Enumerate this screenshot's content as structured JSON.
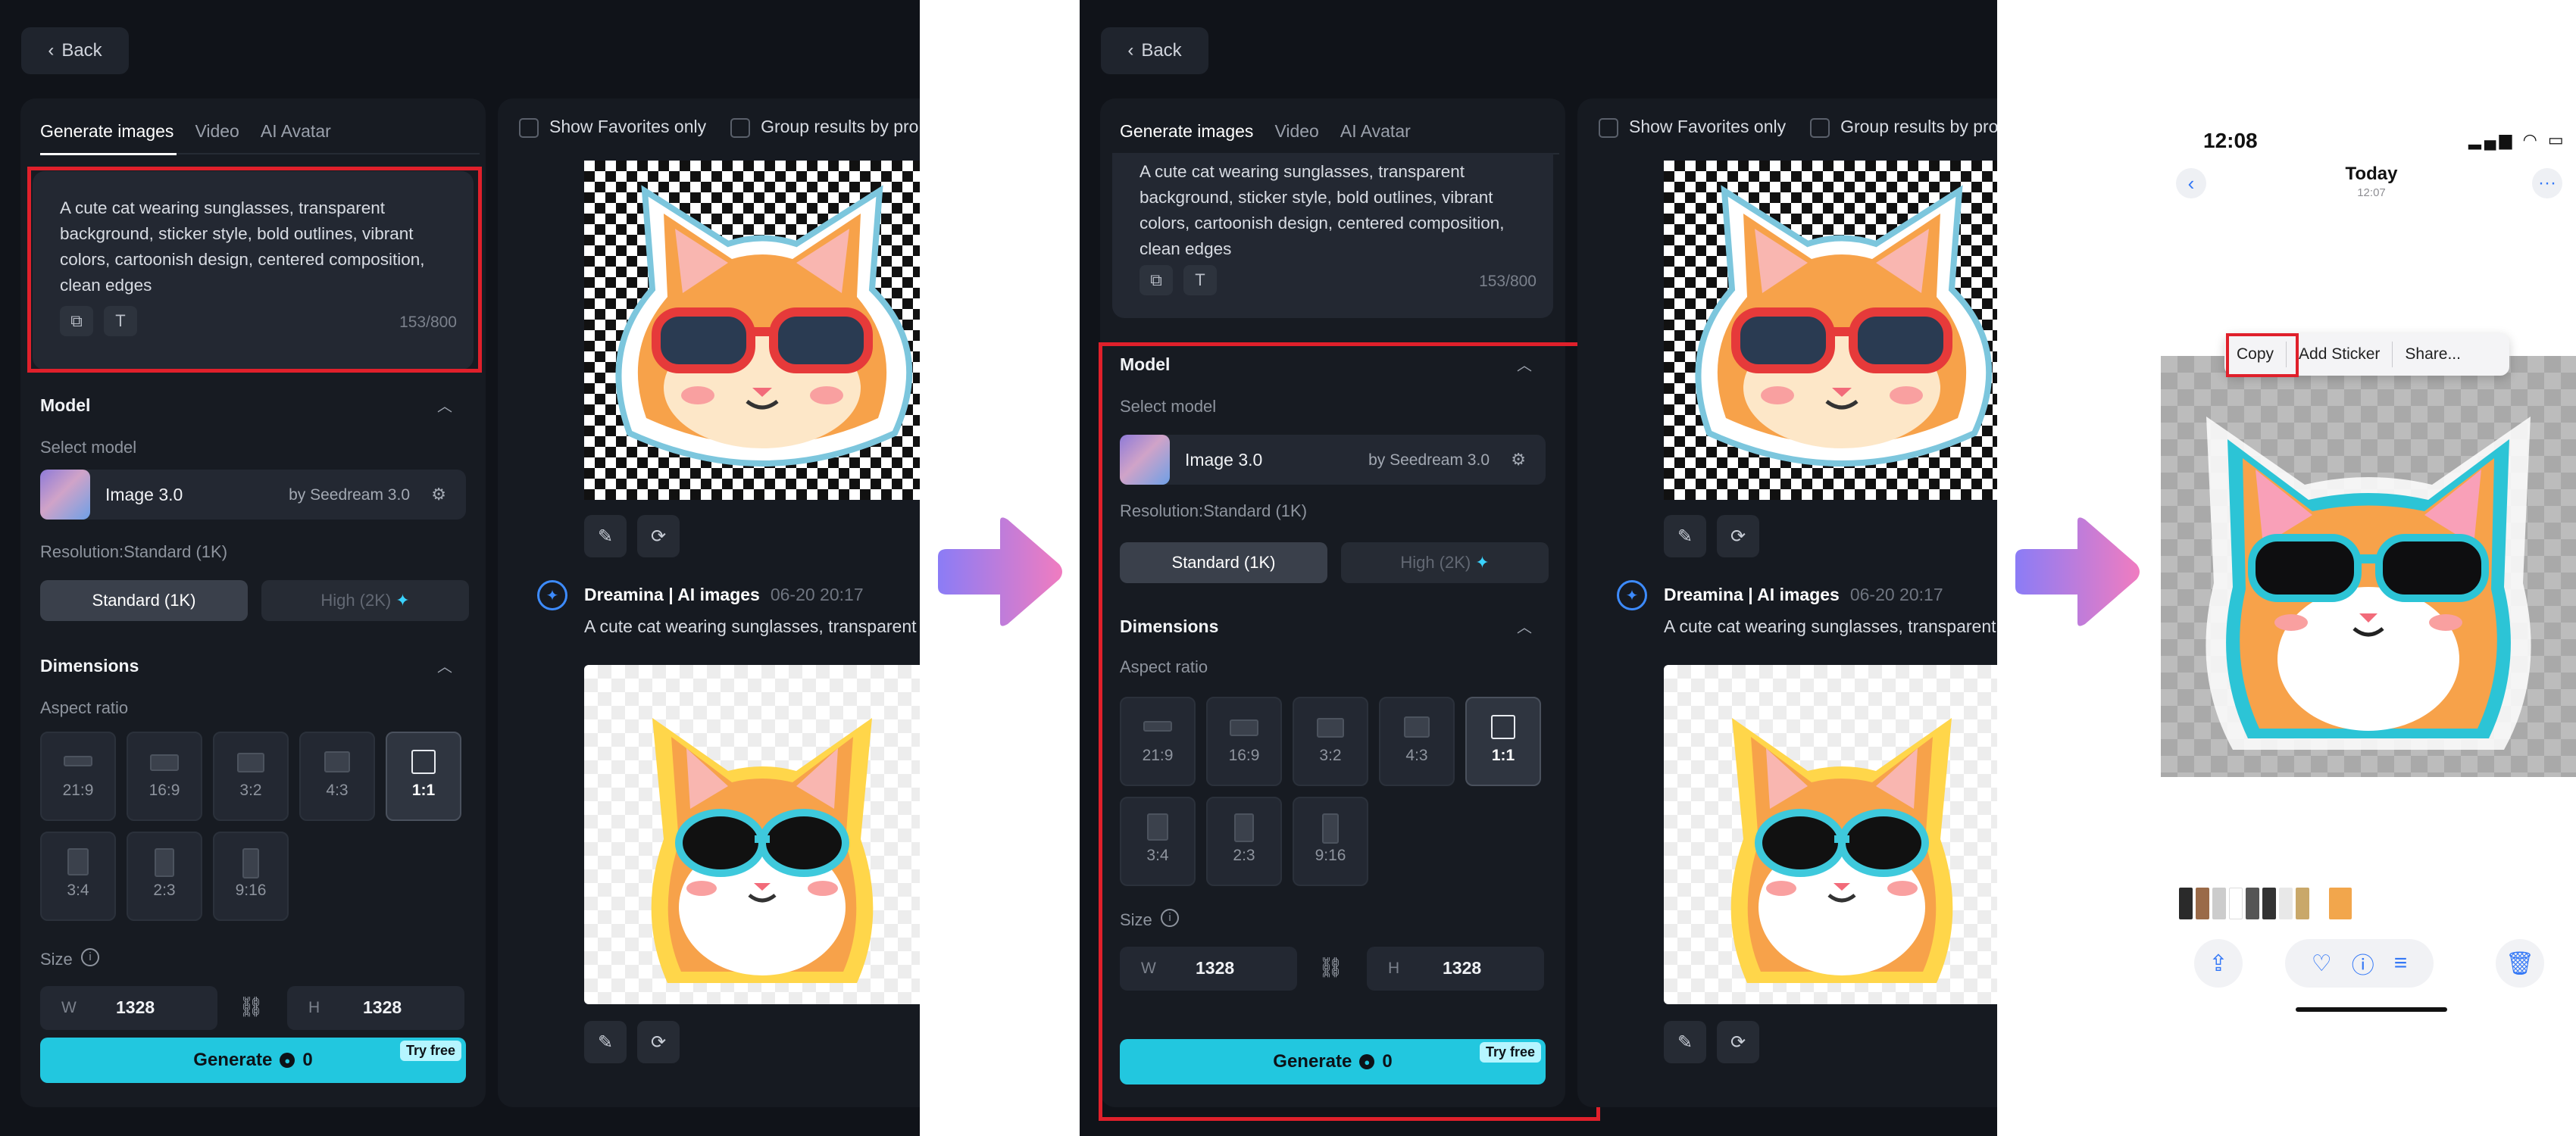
{
  "frame1": {
    "back_label": "Back",
    "tabs": [
      "Generate images",
      "Video",
      "AI Avatar"
    ],
    "prompt": "A cute cat wearing sunglasses, transparent background, sticker style, bold outlines, vibrant colors, cartoonish design, centered composition, clean edges",
    "counter": "153/800",
    "model_section": "Model",
    "select_model_label": "Select model",
    "model_name": "Image 3.0",
    "model_by": "by Seedream 3.0",
    "resolution_label": "Resolution:Standard (1K)",
    "res_standard": "Standard (1K)",
    "res_high": "High (2K)",
    "dimensions_section": "Dimensions",
    "aspect_label": "Aspect ratio",
    "ratios": [
      "21:9",
      "16:9",
      "3:2",
      "4:3",
      "1:1",
      "3:4",
      "2:3",
      "9:16"
    ],
    "selected_ratio": "1:1",
    "size_label": "Size",
    "width_label": "W",
    "width_value": "1328",
    "height_label": "H",
    "height_value": "1328",
    "generate_label": "Generate",
    "generate_cost": "0",
    "try_free": "Try free",
    "filter_favorites": "Show Favorites only",
    "filter_group": "Group results by prom",
    "author": "Dreamina | AI images",
    "author_date": "06-20  20:17",
    "result_prompt": "A cute cat wearing sunglasses, transparent"
  },
  "frame2": {
    "back_label": "Back",
    "tabs": [
      "Generate images",
      "Video",
      "AI Avatar"
    ],
    "prompt": "A cute cat wearing sunglasses, transparent background, sticker style, bold outlines, vibrant colors, cartoonish design, centered composition, clean edges",
    "counter": "153/800",
    "model_section": "Model",
    "select_model_label": "Select model",
    "model_name": "Image 3.0",
    "model_by": "by Seedream 3.0",
    "resolution_label": "Resolution:Standard (1K)",
    "res_standard": "Standard (1K)",
    "res_high": "High (2K)",
    "dimensions_section": "Dimensions",
    "aspect_label": "Aspect ratio",
    "ratios": [
      "21:9",
      "16:9",
      "3:2",
      "4:3",
      "1:1",
      "3:4",
      "2:3",
      "9:16"
    ],
    "selected_ratio": "1:1",
    "size_label": "Size",
    "width_label": "W",
    "width_value": "1328",
    "height_label": "H",
    "height_value": "1328",
    "generate_label": "Generate",
    "generate_cost": "0",
    "try_free": "Try free",
    "filter_favorites": "Show Favorites only",
    "filter_group": "Group results by prom",
    "author": "Dreamina | AI images",
    "author_date": "06-20  20:17",
    "result_prompt": "A cute cat wearing sunglasses, transparent"
  },
  "phone": {
    "time": "12:08",
    "title": "Today",
    "subtitle": "12:07",
    "menu": [
      "Copy",
      "Add Sticker",
      "Share..."
    ]
  },
  "colors": {
    "accent": "#22c7df",
    "highlight_box": "#e0202b",
    "ios_blue": "#3478f6",
    "arrow_gradient_start": "#8b7cf6",
    "arrow_gradient_end": "#f07cc0"
  },
  "icons": [
    "chevron-left-icon",
    "chevron-up-icon",
    "image-edit-icon",
    "text-format-icon",
    "tune-icon",
    "info-icon",
    "link-icon",
    "coin-icon",
    "sparkle-icon",
    "edit-icon",
    "retry-icon",
    "dreamina-logo-icon",
    "share-icon",
    "heart-icon",
    "trash-icon",
    "more-icon",
    "right-arrow-icon"
  ]
}
